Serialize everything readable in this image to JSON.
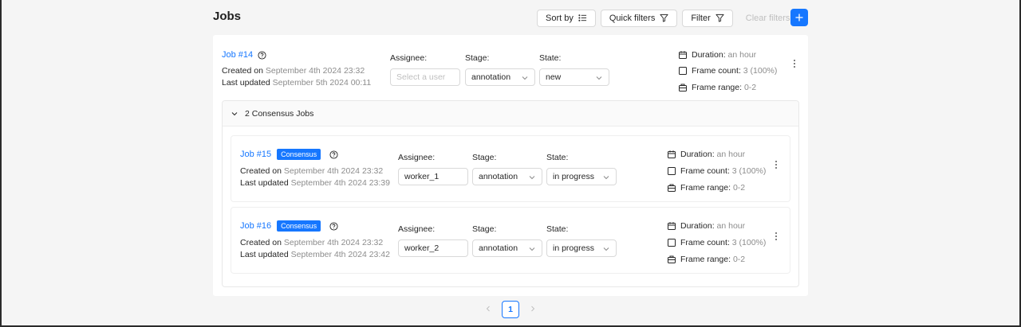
{
  "page": {
    "title": "Jobs"
  },
  "toolbar": {
    "sort_label": "Sort by",
    "quick_filters_label": "Quick filters",
    "filter_label": "Filter",
    "clear_label": "Clear filters",
    "add_label": "+"
  },
  "job14": {
    "title": "Job #14",
    "created_label": "Created on",
    "created": "September 4th 2024 23:32",
    "updated_label": "Last updated",
    "updated": "September 5th 2024 00:11",
    "assignee_label": "Assignee:",
    "assignee_placeholder": "Select a user",
    "stage_label": "Stage:",
    "stage": "annotation",
    "state_label": "State:",
    "state": "new",
    "duration_label": "Duration:",
    "duration": "an hour",
    "frame_count_label": "Frame count:",
    "frame_count": "3 (100%)",
    "frame_range_label": "Frame range:",
    "frame_range": "0-2"
  },
  "consensus": {
    "header": "2 Consensus Jobs"
  },
  "job15": {
    "title": "Job #15",
    "badge": "Consensus",
    "created_label": "Created on",
    "created": "September 4th 2024 23:32",
    "updated_label": "Last updated",
    "updated": "September 4th 2024 23:39",
    "assignee_label": "Assignee:",
    "assignee": "worker_1",
    "stage_label": "Stage:",
    "stage": "annotation",
    "state_label": "State:",
    "state": "in progress",
    "duration_label": "Duration:",
    "duration": "an hour",
    "frame_count_label": "Frame count:",
    "frame_count": "3 (100%)",
    "frame_range_label": "Frame range:",
    "frame_range": "0-2"
  },
  "job16": {
    "title": "Job #16",
    "badge": "Consensus",
    "created_label": "Created on",
    "created": "September 4th 2024 23:32",
    "updated_label": "Last updated",
    "updated": "September 4th 2024 23:42",
    "assignee_label": "Assignee:",
    "assignee": "worker_2",
    "stage_label": "Stage:",
    "stage": "annotation",
    "state_label": "State:",
    "state": "in progress",
    "duration_label": "Duration:",
    "duration": "an hour",
    "frame_count_label": "Frame count:",
    "frame_count": "3 (100%)",
    "frame_range_label": "Frame range:",
    "frame_range": "0-2"
  },
  "pagination": {
    "current_page": "1"
  },
  "colors": {
    "accent": "#1677ff",
    "muted": "#8c8c8c",
    "border": "#d9d9d9"
  },
  "icons": [
    "sort-icon",
    "filter-icon",
    "plus-icon",
    "help-icon",
    "calendar-icon",
    "checkbox-icon",
    "frame-range-icon",
    "kebab-icon",
    "chevron-down-icon",
    "chevron-left-icon",
    "chevron-right-icon"
  ]
}
